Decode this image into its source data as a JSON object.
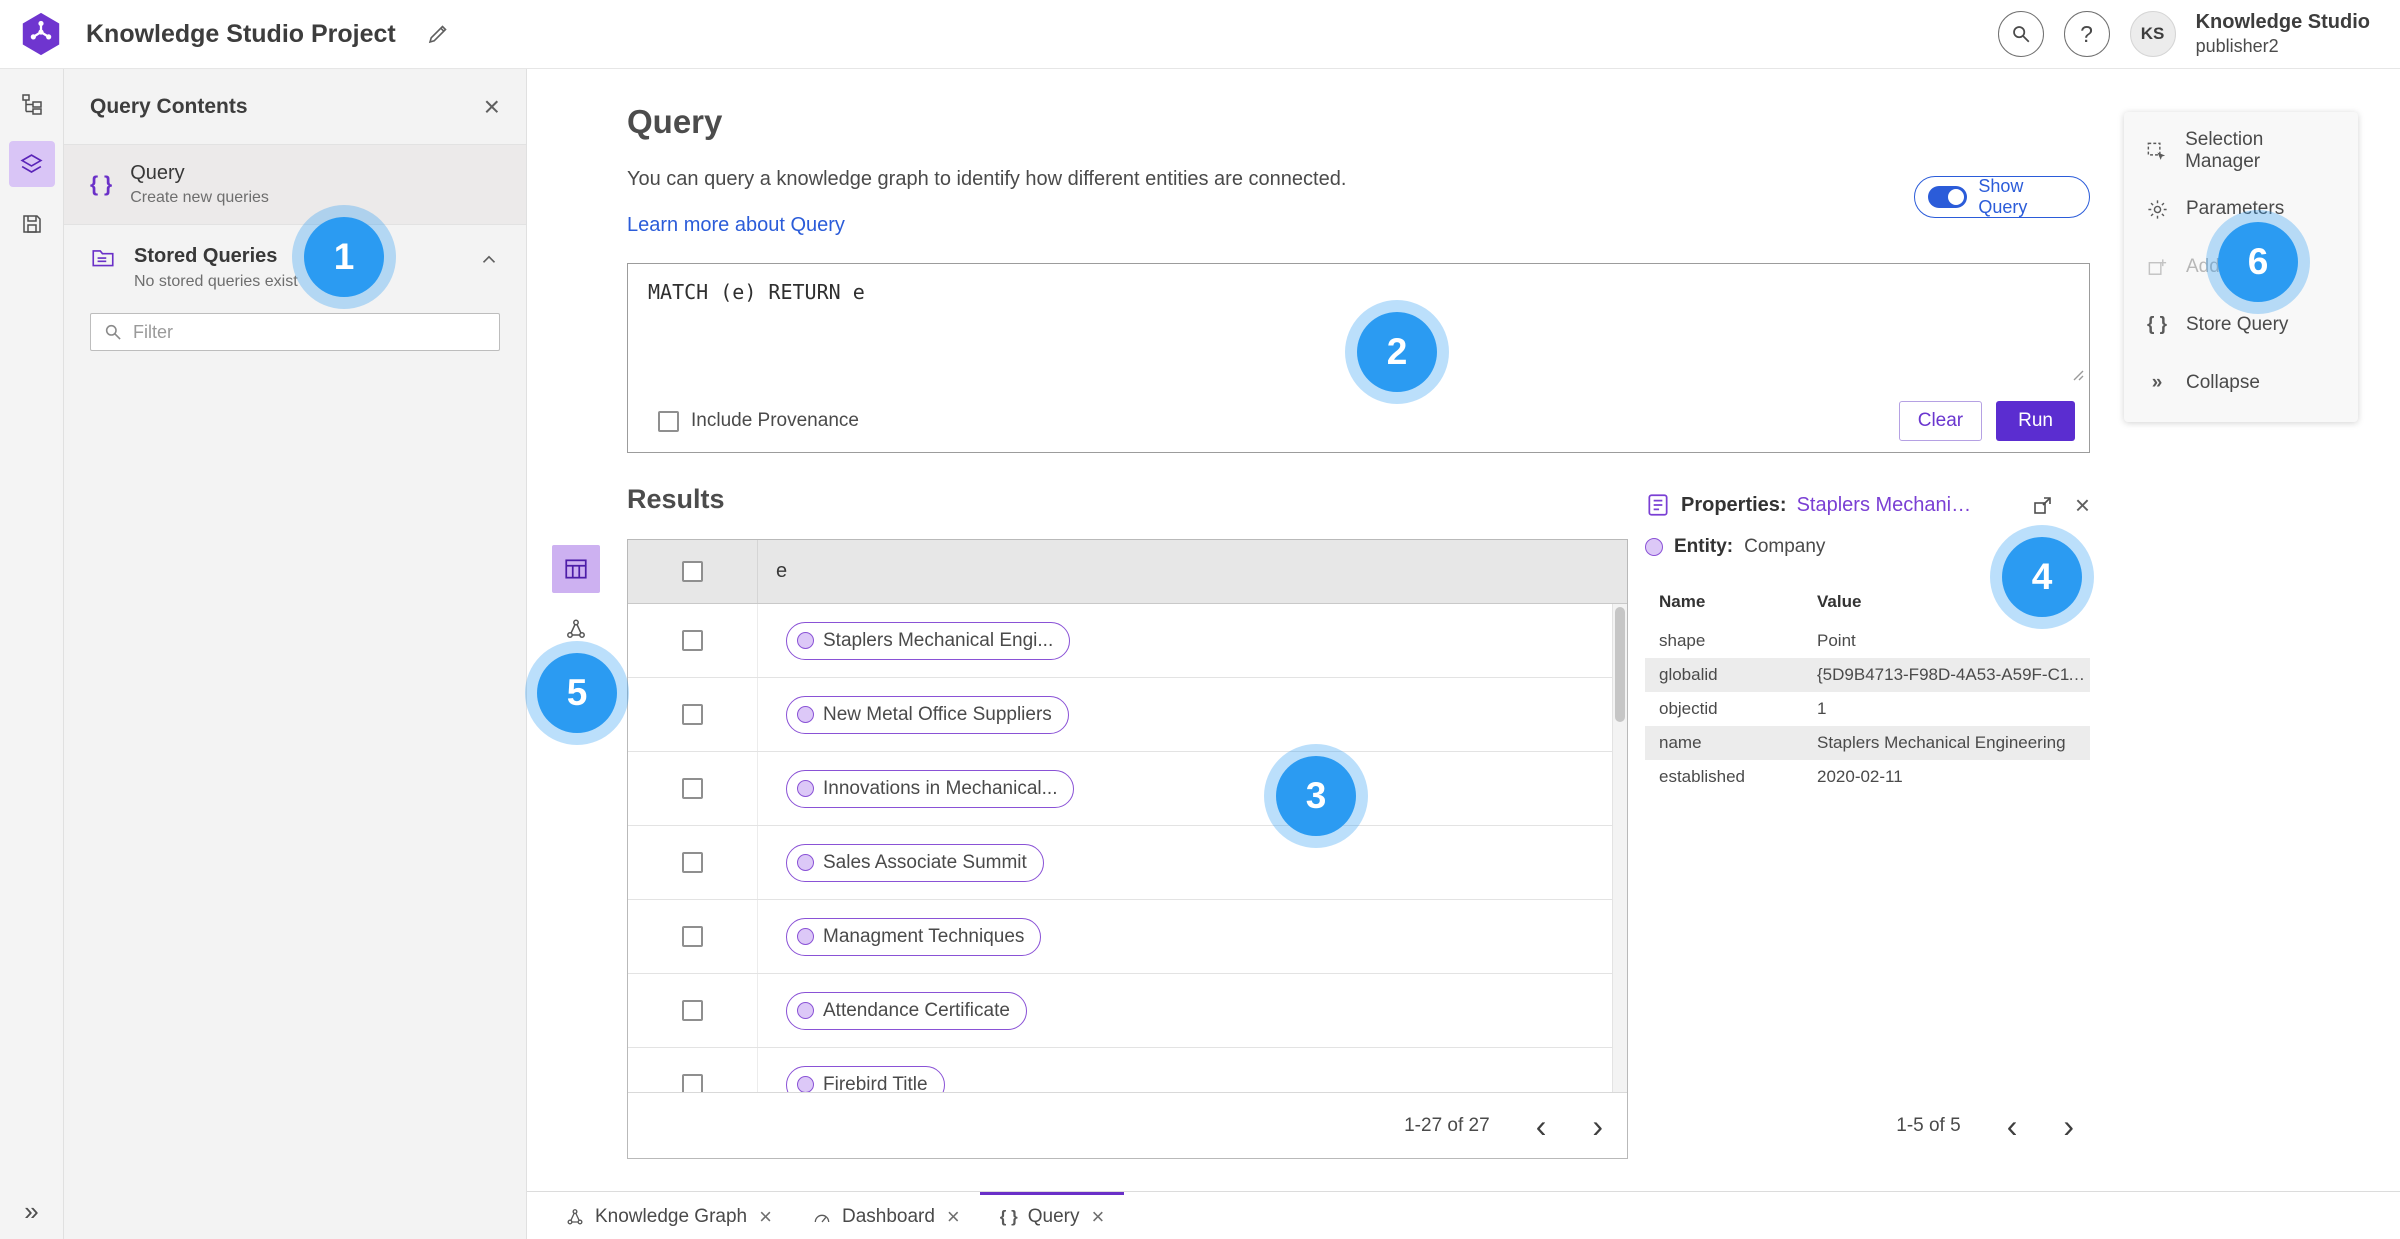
{
  "icons": {
    "close": "×",
    "collapse": "»",
    "chevron_left": "‹",
    "chevron_right": "›",
    "braces": "{ }",
    "question": "?"
  },
  "colors": {
    "accent_purple": "#6a30c8",
    "run_button": "#5b2dd0",
    "link_blue": "#2b5cd9",
    "badge_blue": "#2b9bf2"
  },
  "topbar": {
    "title": "Knowledge Studio Project",
    "user_name": "Knowledge Studio",
    "user_role": "publisher2",
    "avatar": "KS"
  },
  "left_panel": {
    "title": "Query Contents",
    "query_item": {
      "title": "Query",
      "subtitle": "Create new queries"
    },
    "stored": {
      "title": "Stored Queries",
      "subtitle": "No stored queries exist"
    },
    "filter_placeholder": "Filter"
  },
  "query": {
    "title": "Query",
    "description": "You can query a knowledge graph to identify how different entities are connected.",
    "learn_link": "Learn more about Query",
    "show_query_label": "Show Query",
    "query_text": "MATCH (e) RETURN e",
    "include_provenance_label": "Include Provenance",
    "clear_label": "Clear",
    "run_label": "Run"
  },
  "results": {
    "title": "Results",
    "column_header": "e",
    "pagination": "1-27 of 27",
    "rows": [
      "Staplers Mechanical Engi...",
      "New Metal Office Suppliers",
      "Innovations in Mechanical...",
      "Sales Associate Summit",
      "Managment Techniques",
      "Attendance Certificate",
      "Firebird Title"
    ]
  },
  "properties": {
    "label": "Properties:",
    "entity_link": "Staplers Mechanic...",
    "entity_label": "Entity:",
    "entity_value": "Company",
    "columns": {
      "name": "Name",
      "value": "Value"
    },
    "rows": [
      {
        "name": "shape",
        "value": "Point"
      },
      {
        "name": "globalid",
        "value": "{5D9B4713-F98D-4A53-A59F-C11..."
      },
      {
        "name": "objectid",
        "value": "1"
      },
      {
        "name": "name",
        "value": "Staplers Mechanical Engineering"
      },
      {
        "name": "established",
        "value": "2020-02-11"
      }
    ],
    "pagination": "1-5 of 5"
  },
  "side_menu": {
    "items": [
      {
        "label": "Selection Manager"
      },
      {
        "label": "Parameters"
      },
      {
        "label": "Add To Map"
      },
      {
        "label": "Store Query"
      },
      {
        "label": "Collapse"
      }
    ]
  },
  "tabs": [
    {
      "label": "Knowledge Graph"
    },
    {
      "label": "Dashboard"
    },
    {
      "label": "Query"
    }
  ],
  "badges": [
    "1",
    "2",
    "3",
    "4",
    "5",
    "6"
  ]
}
